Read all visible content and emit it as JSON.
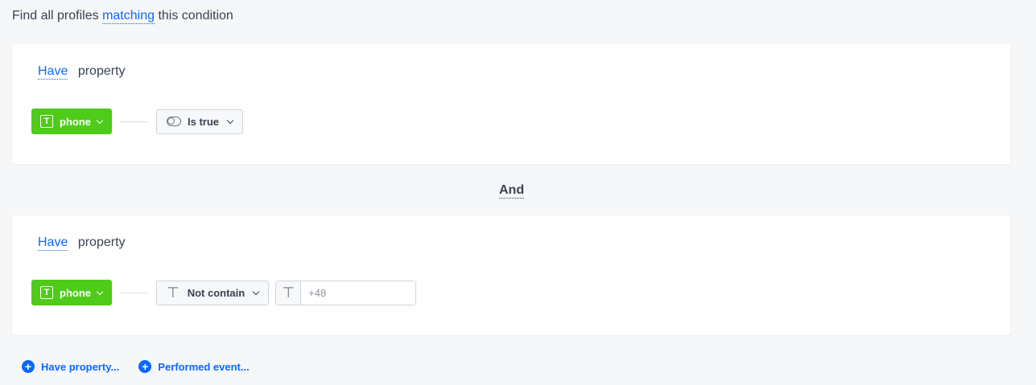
{
  "header": {
    "prefix": "Find all profiles",
    "match_mode": "matching",
    "suffix": "this condition"
  },
  "conditions": [
    {
      "mode": "Have",
      "kind": "property",
      "property": "phone",
      "operator": "Is true"
    },
    {
      "mode": "Have",
      "kind": "property",
      "property": "phone",
      "operator": "Not contain",
      "value_placeholder": "+48"
    }
  ],
  "joiner": "And",
  "footer": {
    "add_property": "Have property...",
    "add_event": "Performed event..."
  },
  "colors": {
    "accent": "#0b68ff",
    "green": "#4fcb1a",
    "text": "#384350",
    "background": "#f5f7f9"
  }
}
